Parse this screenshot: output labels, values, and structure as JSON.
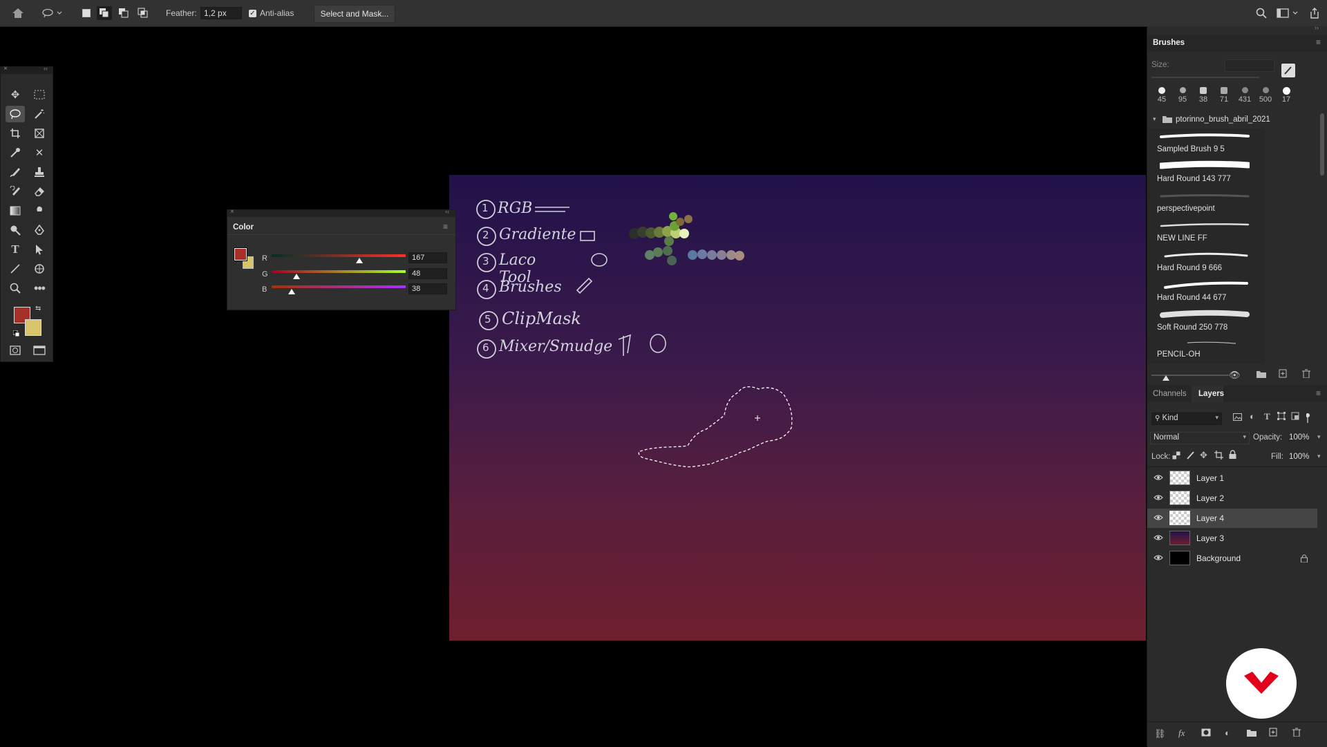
{
  "options_bar": {
    "feather_label": "Feather:",
    "feather_value": "1,2 px",
    "antialias_label": "Anti-alias",
    "antialias_checked": true,
    "select_mask_label": "Select and Mask..."
  },
  "color_panel": {
    "title": "Color",
    "channels": [
      {
        "label": "R",
        "value": "167",
        "fraction": 0.655
      },
      {
        "label": "G",
        "value": "48",
        "fraction": 0.188
      },
      {
        "label": "B",
        "value": "38",
        "fraction": 0.149
      }
    ],
    "foreground": "#a73026",
    "background": "#d8c56b"
  },
  "canvas_notes": [
    "RGB",
    "Gradiente",
    "Laco Tool",
    "Brushes",
    "ClipMask",
    "Mixer/Smudge"
  ],
  "canvas_note_numbers": [
    "1",
    "2",
    "3",
    "4",
    "5",
    "6"
  ],
  "brushes_panel": {
    "title": "Brushes",
    "size_label": "Size:",
    "recent_sizes": [
      "45",
      "95",
      "38",
      "71",
      "431",
      "500",
      "17"
    ],
    "folder_name": "ptorinno_brush_abril_2021",
    "brushes": [
      "Sampled Brush 9 5",
      "Hard Round 143 777",
      "perspectivepoint",
      "NEW LINE FF",
      "Hard Round 9 666",
      "Hard Round 44 677",
      "Soft Round 250 778",
      "PENCIL-OH"
    ]
  },
  "layers_panel": {
    "tabs": [
      "Channels",
      "Layers"
    ],
    "active_tab": "Layers",
    "filter_label": "Kind",
    "blend_mode": "Normal",
    "opacity_label": "Opacity:",
    "opacity_value": "100%",
    "lock_label": "Lock:",
    "fill_label": "Fill:",
    "fill_value": "100%",
    "layers": [
      {
        "name": "Layer 1",
        "thumb": "checker",
        "selected": false
      },
      {
        "name": "Layer 2",
        "thumb": "checker",
        "selected": false
      },
      {
        "name": "Layer 4",
        "thumb": "checker",
        "selected": true
      },
      {
        "name": "Layer 3",
        "thumb": "gradient",
        "selected": false
      },
      {
        "name": "Background",
        "thumb": "black",
        "selected": false
      }
    ]
  },
  "colors": {
    "panel_bg": "#2b2b2b",
    "accent_logo": "#e3001b"
  }
}
